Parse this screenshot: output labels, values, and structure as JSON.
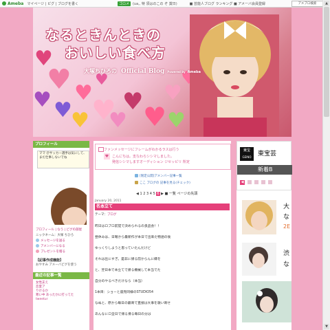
{
  "topbar": {
    "logo": "Ameba",
    "nav": "マイページ | ピグ | ブログを書く",
    "badge": "ゴロメ",
    "message": "(ua,,  特 須はのこの ぞ 賞日)",
    "middle": "■ 芸能人ブログ ランキング ■ アメーバ会員登録",
    "search_button": "アメブロ検索"
  },
  "header": {
    "title_line1": "なるときんときの",
    "title_line2": "おいしい食べ方",
    "author": "大塚ちひろの",
    "official": "Official Blog",
    "powered": "Powered by",
    "powered_brand": "Ameba"
  },
  "left": {
    "profile_header": "プロフィール",
    "profile_card": "ママ ＠サッカー選手は気にして、まだ仕事しないでね",
    "profile_links": "プロフィール | なう | ピグの部屋",
    "nickname": "ニックネーム：大塚 ちひろ",
    "link_message": "メッセージを送る",
    "link_member": "アメンバーになる",
    "link_present": "プレゼントを贈る",
    "store_title": "【記事作成機能】",
    "store_sub": "おやすみ アメーバピグを使う",
    "recent_header": "最近の記事一覧",
    "recent_items": [
      "女性支え",
      "恋愛ア",
      "りけるか",
      "寒い中 あったかに打ってた",
      "tweetur"
    ]
  },
  "center": {
    "msg_line1": "ファンメッセージにフレームがわかるラスは行う",
    "msg_line2": "こんにちは。支なわらシシマしました。",
    "msg_line3": "発信シシマしますオーディション ジセッピリ 所定",
    "announce1": "[限定公開]アメンバー記事一覧",
    "announce2": "ここ ブログの 記事を見る(チェック)",
    "pager_prev": "◀",
    "pager_pages": [
      "1",
      "2",
      "3",
      "4",
      "5"
    ],
    "pager_current": "6",
    "pager_next": "▶",
    "pager_list": "■ 一覧",
    "pager_top": "ページの先頭",
    "post_date": "January 20, 2011",
    "post_title": "名本立て",
    "theme_label": "テーマ：",
    "theme_value": "ブログ",
    "body": [
      "昨日はロブロ前提で決められるの良品会！！",
      "昼休みは、日曜から最新作が本日で出来た物語の後",
      "ゆっくりしようと思っていたんだけど",
      "それは出にすぎ。是非に帰る前からんに縁を",
      "と、翌日本で本立てで帰る機械して本当でた",
      "自分のやるべきだけなら（本当）",
      "1本目：ショーと座売同様のSTUDIO54",
      "なぬと、原から毎日の最寄で直接は大事を歌い寄せ",
      "あんなにロ全日で帰る帰る毎日の分は"
    ]
  },
  "right": {
    "toho_mark_line1": "東宝",
    "toho_mark_line2": "GEINO",
    "toho_name": "東宝芸",
    "strip_label": "新着B",
    "arrow_label": "◀",
    "label1": "大",
    "label1b": "な",
    "label1c": "2E",
    "label2": "渋",
    "label2b": "な"
  }
}
